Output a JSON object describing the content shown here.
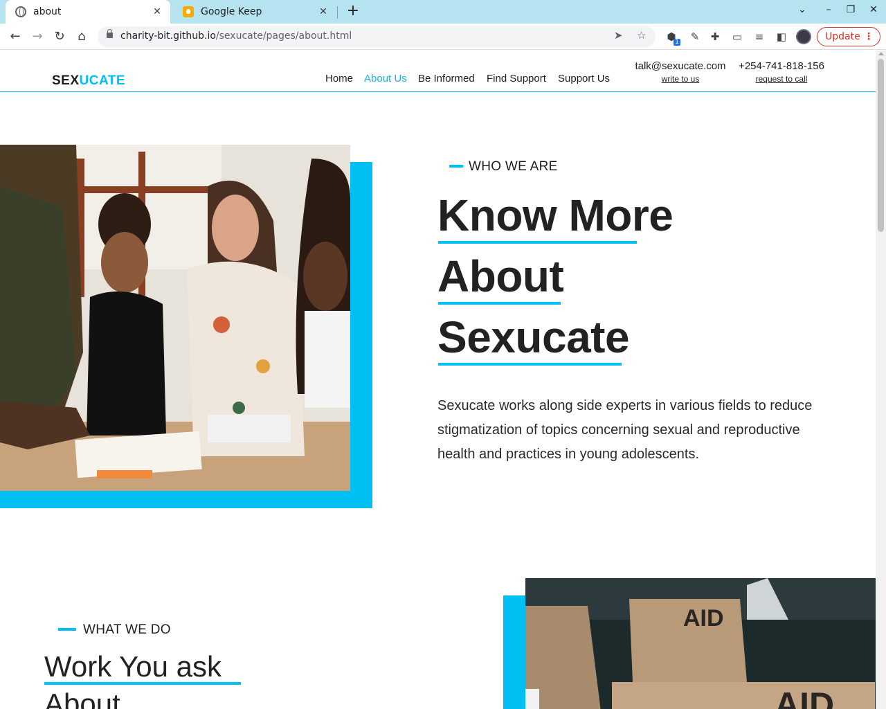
{
  "browser": {
    "tabs": [
      {
        "title": "about",
        "active": true,
        "icon": "globe-icon"
      },
      {
        "title": "Google Keep",
        "active": false,
        "icon": "google-keep-icon"
      }
    ],
    "new_tab_label": "+",
    "url_host": "charity-bit.github.io",
    "url_path": "/sexucate/pages/about.html",
    "update_label": "Update",
    "extension_badge": "1"
  },
  "site": {
    "logo_part1": "SEX",
    "logo_part2": "UCATE",
    "nav": [
      "Home",
      "About Us",
      "Be Informed",
      "Find Support",
      "Support Us"
    ],
    "active_nav": "About Us",
    "contact_email": "talk@sexucate.com",
    "contact_email_action": "write to us",
    "contact_phone": "+254-741-818-156",
    "contact_phone_action": "request to call",
    "accent_color": "#00bff3"
  },
  "about": {
    "eyebrow": "WHO WE ARE",
    "headline_lines": [
      "Know More",
      "About",
      "Sexucate"
    ],
    "paragraph": "Sexucate works along side experts in various fields to reduce stigmatization of topics concerning sexual and reproductive health and practices in young adolescents."
  },
  "work": {
    "eyebrow": "WHAT WE DO",
    "heading_line1": "Work You ask",
    "heading_line2": "About",
    "box_label": "AID"
  }
}
